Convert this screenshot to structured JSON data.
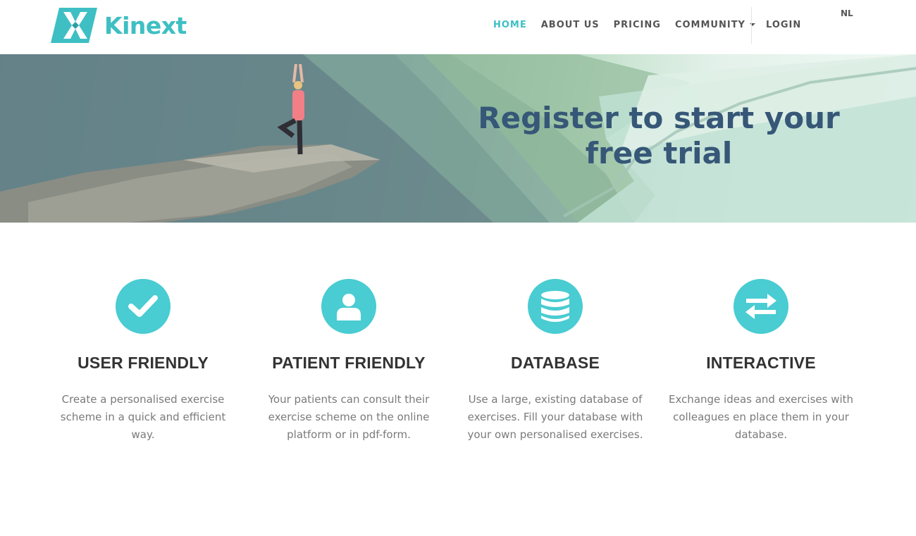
{
  "brand": {
    "name": "Kinext",
    "accent": "#3ebfc3"
  },
  "nav": {
    "items": [
      {
        "label": "HOME",
        "active": true
      },
      {
        "label": "ABOUT US",
        "active": false
      },
      {
        "label": "PRICING",
        "active": false
      },
      {
        "label": "COMMUNITY",
        "active": false,
        "dropdown": true
      }
    ],
    "login": "LOGIN",
    "language": "NL"
  },
  "hero": {
    "title": "Register to start your free trial",
    "title_color": "#365777"
  },
  "features": [
    {
      "icon": "checkmark-icon",
      "title": "USER FRIENDLY",
      "text": "Create a personalised exercise scheme in a quick and efficient way."
    },
    {
      "icon": "user-icon",
      "title": "PATIENT FRIENDLY",
      "text": "Your patients can consult their exercise scheme on the online platform or in pdf-form."
    },
    {
      "icon": "database-icon",
      "title": "DATABASE",
      "text": "Use a large, existing database of exercises. Fill your database with your own personalised exercises."
    },
    {
      "icon": "exchange-arrows-icon",
      "title": "INTERACTIVE",
      "text": "Exchange ideas and exercises with colleagues en place them in your database."
    }
  ],
  "colors": {
    "icon_circle": "#49ccd2",
    "text_muted": "#7a7a7a",
    "nav_text": "#555555"
  }
}
